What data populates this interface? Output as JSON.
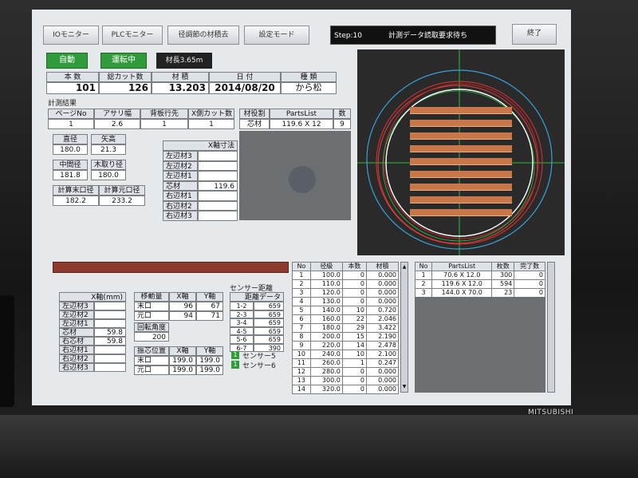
{
  "tabs": [
    {
      "label": "IOモニター"
    },
    {
      "label": "PLCモニター"
    },
    {
      "label": "径調節の材積去"
    },
    {
      "label": "設定モード"
    }
  ],
  "status": {
    "step": "Step:10",
    "message": "計測データ読取要求待ち"
  },
  "end_button": "終了",
  "mode": {
    "auto": "自動",
    "running": "運転中",
    "length_label": "材長3.65m"
  },
  "summary": {
    "headers": [
      "本 数",
      "総カット数",
      "材 積",
      "日 付",
      "種 類"
    ],
    "values": [
      "101",
      "126",
      "13.203",
      "2014/08/20",
      "から松"
    ]
  },
  "section_measure": "計測結果",
  "measure": {
    "headers": [
      "ページNo",
      "アサリ幅",
      "背板行先",
      "X側カット数"
    ],
    "values": [
      "1",
      "2.6",
      "1",
      "1"
    ]
  },
  "parts": {
    "headers": [
      "材役割",
      "PartsList",
      "数"
    ],
    "row": [
      "芯材",
      "119.6 X 12",
      "9"
    ]
  },
  "diam": {
    "labels": [
      "直径",
      "矢高",
      "中間径",
      "木取り径",
      "計算末口径",
      "計算元口径"
    ],
    "values": [
      "180.0",
      "21.3",
      "181.8",
      "180.0",
      "182.2",
      "233.2"
    ]
  },
  "xside": {
    "header": "X軸寸法",
    "rows": [
      {
        "label": "左辺材3",
        "value": ""
      },
      {
        "label": "左辺材2",
        "value": ""
      },
      {
        "label": "左辺材1",
        "value": ""
      },
      {
        "label": "芯材",
        "value": "119.6"
      },
      {
        "label": "右辺材1",
        "value": ""
      },
      {
        "label": "右辺材2",
        "value": ""
      },
      {
        "label": "右辺材3",
        "value": ""
      }
    ]
  },
  "lower_left": {
    "header": "X軸(mm)",
    "rows": [
      {
        "label": "左辺材3",
        "value": ""
      },
      {
        "label": "左辺材2",
        "value": ""
      },
      {
        "label": "左辺材1",
        "value": ""
      },
      {
        "label": "芯材",
        "value": "59.8"
      },
      {
        "label": "右芯材",
        "value": "59.8"
      },
      {
        "label": "右辺材1",
        "value": ""
      },
      {
        "label": "右辺材2",
        "value": ""
      },
      {
        "label": "右辺材3",
        "value": ""
      }
    ]
  },
  "shift": {
    "headers": [
      "移動量",
      "X軸",
      "Y軸"
    ],
    "rows": [
      [
        "末口",
        "96",
        "67"
      ],
      [
        "元口",
        "94",
        "71"
      ]
    ]
  },
  "angle": {
    "label": "回転角度",
    "value": "200"
  },
  "center": {
    "headers": [
      "振芯位置",
      "X軸",
      "Y軸"
    ],
    "rows": [
      [
        "末口",
        "199.0",
        "199.0"
      ],
      [
        "元口",
        "199.0",
        "199.0"
      ]
    ]
  },
  "sensor": {
    "title": "センサー距離",
    "header": "距離データ",
    "rows": [
      [
        "1-2",
        "659"
      ],
      [
        "2-3",
        "659"
      ],
      [
        "3-4",
        "659"
      ],
      [
        "4-5",
        "659"
      ],
      [
        "5-6",
        "659"
      ],
      [
        "6-7",
        "390"
      ]
    ],
    "legend": [
      {
        "box": "1",
        "label": "センサー5"
      },
      {
        "box": "1",
        "label": "センサー6"
      }
    ]
  },
  "diam_table": {
    "headers": [
      "No",
      "径級",
      "本数",
      "材積"
    ],
    "rows": [
      [
        "1",
        "100.0",
        "0",
        "0.000"
      ],
      [
        "2",
        "110.0",
        "0",
        "0.000"
      ],
      [
        "3",
        "120.0",
        "0",
        "0.000"
      ],
      [
        "4",
        "130.0",
        "0",
        "0.000"
      ],
      [
        "5",
        "140.0",
        "10",
        "0.720"
      ],
      [
        "6",
        "160.0",
        "22",
        "2.046"
      ],
      [
        "7",
        "180.0",
        "29",
        "3.422"
      ],
      [
        "8",
        "200.0",
        "15",
        "2.190"
      ],
      [
        "9",
        "220.0",
        "14",
        "2.478"
      ],
      [
        "10",
        "240.0",
        "10",
        "2.100"
      ],
      [
        "11",
        "260.0",
        "1",
        "0.247"
      ],
      [
        "12",
        "280.0",
        "0",
        "0.000"
      ],
      [
        "13",
        "300.0",
        "0",
        "0.000"
      ],
      [
        "14",
        "320.0",
        "0",
        "0.000"
      ]
    ]
  },
  "parts_table": {
    "headers": [
      "No",
      "PartsList",
      "枚数",
      "完了数"
    ],
    "rows": [
      [
        "1",
        "70.6 X 12.0",
        "300",
        "0"
      ],
      [
        "2",
        "119.6 X 12.0",
        "594",
        "0"
      ],
      [
        "3",
        "144.0 X 70.0",
        "23",
        "0"
      ]
    ]
  },
  "brand": "MITSUBISHI",
  "colors": {
    "accent_green": "#2f9b3b",
    "lumber": "#c87848",
    "panel": "#e6e9ec"
  }
}
